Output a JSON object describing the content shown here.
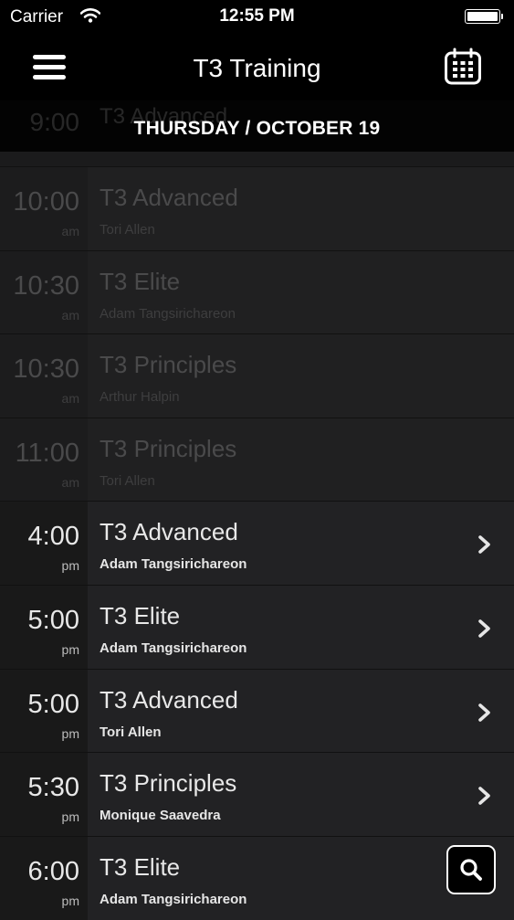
{
  "status_bar": {
    "carrier": "Carrier",
    "time": "12:55 PM"
  },
  "nav": {
    "title": "T3 Training"
  },
  "date_header": "THURSDAY / OCTOBER 19",
  "ghost_row": {
    "time": "9:00",
    "title": "T3 Advanced"
  },
  "schedule": [
    {
      "time": "10:00",
      "ampm": "am",
      "class": "T3 Advanced",
      "instructor": "Tori Allen",
      "past": true
    },
    {
      "time": "10:30",
      "ampm": "am",
      "class": "T3 Elite",
      "instructor": "Adam Tangsirichareon",
      "past": true
    },
    {
      "time": "10:30",
      "ampm": "am",
      "class": "T3 Principles",
      "instructor": "Arthur Halpin",
      "past": true
    },
    {
      "time": "11:00",
      "ampm": "am",
      "class": "T3 Principles",
      "instructor": "Tori Allen",
      "past": true
    },
    {
      "time": "4:00",
      "ampm": "pm",
      "class": "T3 Advanced",
      "instructor": "Adam Tangsirichareon",
      "past": false
    },
    {
      "time": "5:00",
      "ampm": "pm",
      "class": "T3 Elite",
      "instructor": "Adam Tangsirichareon",
      "past": false
    },
    {
      "time": "5:00",
      "ampm": "pm",
      "class": "T3 Advanced",
      "instructor": "Tori Allen",
      "past": false
    },
    {
      "time": "5:30",
      "ampm": "pm",
      "class": "T3 Principles",
      "instructor": "Monique Saavedra",
      "past": false
    },
    {
      "time": "6:00",
      "ampm": "pm",
      "class": "T3 Elite",
      "instructor": "Adam Tangsirichareon",
      "past": false
    }
  ],
  "icons": {
    "menu": "hamburger-icon",
    "calendar": "calendar-icon",
    "row_action": "chevron-right-icon",
    "search": "search-icon",
    "wifi": "wifi-icon",
    "battery": "battery-icon"
  },
  "colors": {
    "bar_background": "#000000",
    "list_background": "#222224",
    "past_text": "#4a4a4b",
    "upcoming_text": "#e8e8e8"
  }
}
